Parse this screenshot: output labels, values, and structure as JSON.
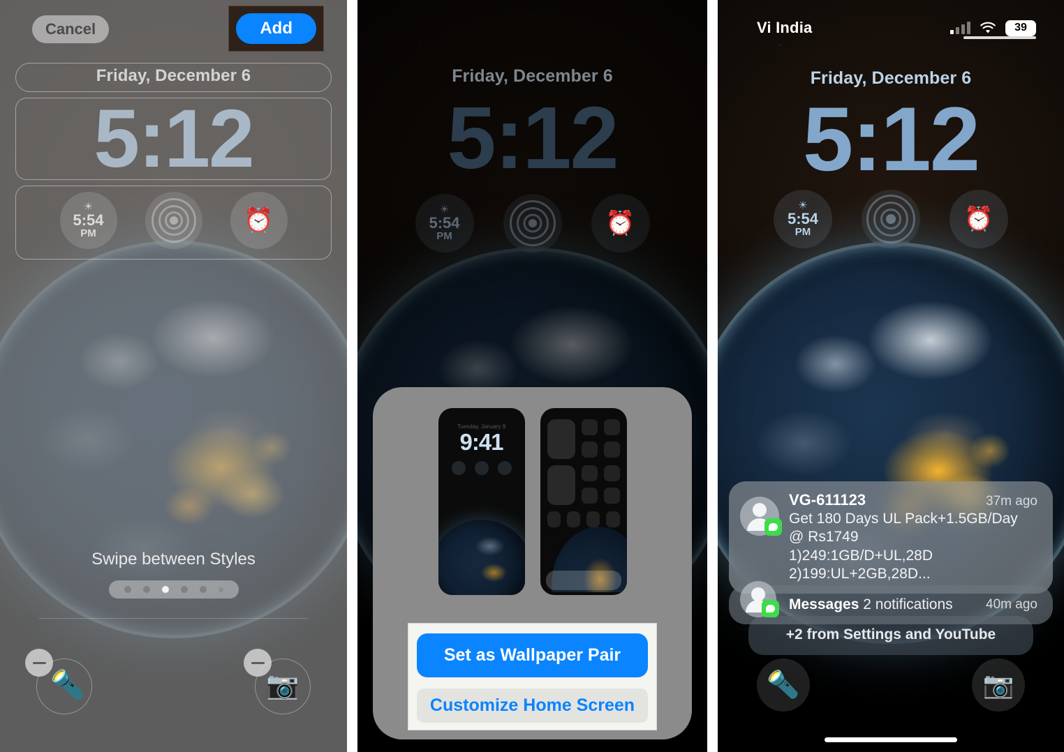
{
  "panel1": {
    "name": "Lock Screen Editor (dimmed)",
    "topbar": {
      "cancel_label": "Cancel",
      "add_label": "Add"
    },
    "lockscreen": {
      "date": "Friday, December 6",
      "time": "5:12",
      "widgets": [
        {
          "icon": "sunset-icon",
          "line1": "5:54",
          "line2": "PM"
        },
        {
          "icon": "rings-icon",
          "line1": "",
          "line2": ""
        },
        {
          "icon": "alarm-clock-icon",
          "line1": "",
          "line2": ""
        }
      ]
    },
    "hint": "Swipe between Styles",
    "pager": {
      "count": 6,
      "active_index": 2
    },
    "controls": {
      "left_icon": "flashlight-icon",
      "right_icon": "camera-icon",
      "remove_badge": "minus-icon"
    }
  },
  "panel2": {
    "name": "Wallpaper Pair action sheet",
    "lockscreen": {
      "date": "Friday, December 6",
      "time": "5:12",
      "widgets": [
        {
          "icon": "sunset-icon",
          "line1": "5:54",
          "line2": "PM"
        },
        {
          "icon": "rings-icon",
          "line1": "",
          "line2": ""
        },
        {
          "icon": "alarm-clock-icon",
          "line1": "",
          "line2": ""
        }
      ]
    },
    "preview": {
      "lock_date": "Tuesday, January 9",
      "lock_time": "9:41"
    },
    "buttons": {
      "primary": "Set as Wallpaper Pair",
      "secondary": "Customize Home Screen"
    }
  },
  "panel3": {
    "name": "Applied Lock Screen",
    "statusbar": {
      "carrier": "Vi India",
      "battery": "39",
      "wifi_icon": "wifi-icon",
      "signal_icon": "cellular-bars-icon"
    },
    "lockscreen": {
      "date": "Friday, December 6",
      "time": "5:12",
      "widgets": [
        {
          "icon": "sunset-icon",
          "line1": "5:54",
          "line2": "PM"
        },
        {
          "icon": "rings-icon",
          "line1": "",
          "line2": ""
        },
        {
          "icon": "alarm-clock-icon",
          "line1": "",
          "line2": ""
        }
      ]
    },
    "notifications": [
      {
        "title": "VG-611123",
        "time": "37m ago",
        "lines": [
          "Get 180 Days UL Pack+1.5GB/Day",
          "@ Rs1749",
          "1)249:1GB/D+UL,28D",
          "2)199:UL+2GB,28D..."
        ]
      },
      {
        "app": "Messages",
        "summary": "2 notifications",
        "time": "40m ago"
      },
      {
        "more": "+2 from Settings and YouTube"
      }
    ],
    "controls": {
      "left_icon": "flashlight-icon",
      "right_icon": "camera-icon"
    }
  },
  "colors": {
    "accent_blue": "#0a84ff",
    "clock_blue": "#83a7ca",
    "date_blue": "#bdd3e6",
    "badge_green": "#3ddc4a",
    "sheet_gray": "#8b8b8b",
    "highlight_white": "#f4f4f0"
  }
}
